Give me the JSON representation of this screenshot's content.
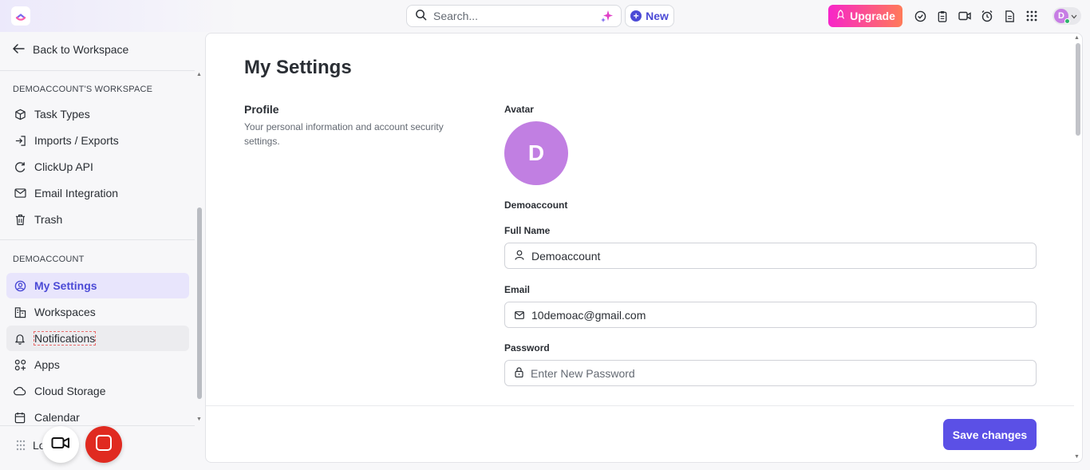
{
  "colors": {
    "accent": "#4b4ad6",
    "active_bg": "#e8e5fc",
    "upgrade_start": "#f725c9",
    "upgrade_end": "#ff7a58",
    "save_button": "#5b50e6",
    "avatar": "#c17fe2",
    "record_red": "#e02a20"
  },
  "header": {
    "search_placeholder": "Search...",
    "new_label": "New",
    "upgrade_label": "Upgrade",
    "avatar_initial": "D",
    "icons": [
      "clickup-logo-icon",
      "search-icon",
      "sparkle-icon",
      "check-circle-icon",
      "clipboard-icon",
      "video-icon",
      "alarm-clock-icon",
      "document-icon",
      "apps-grid-icon",
      "chevron-down-icon"
    ]
  },
  "sidebar": {
    "back_label": "Back to Workspace",
    "workspace_section": {
      "title": "DEMOACCOUNT'S WORKSPACE",
      "items": [
        {
          "label": "Task Types",
          "icon": "cube-icon"
        },
        {
          "label": "Imports / Exports",
          "icon": "import-icon"
        },
        {
          "label": "ClickUp API",
          "icon": "api-icon"
        },
        {
          "label": "Email Integration",
          "icon": "mail-icon"
        },
        {
          "label": "Trash",
          "icon": "trash-icon"
        }
      ]
    },
    "account_section": {
      "title": "DEMOACCOUNT",
      "items": [
        {
          "label": "My Settings",
          "icon": "user-circle-icon",
          "active": true
        },
        {
          "label": "Workspaces",
          "icon": "workspaces-icon"
        },
        {
          "label": "Notifications",
          "icon": "bell-icon",
          "hover": true
        },
        {
          "label": "Apps",
          "icon": "apps-icon"
        },
        {
          "label": "Cloud Storage",
          "icon": "cloud-icon"
        },
        {
          "label": "Calendar",
          "icon": "calendar-icon"
        }
      ]
    },
    "bottom_label_partial": "Lo"
  },
  "main": {
    "title": "My Settings",
    "profile": {
      "heading": "Profile",
      "description": "Your personal information and account security settings."
    },
    "avatar_label": "Avatar",
    "avatar_initial": "D",
    "display_name": "Demoaccount",
    "full_name": {
      "label": "Full Name",
      "value": "Demoaccount"
    },
    "email": {
      "label": "Email",
      "value": "10demoac@gmail.com"
    },
    "password": {
      "label": "Password",
      "placeholder": "Enter New Password"
    },
    "save_label": "Save changes"
  }
}
